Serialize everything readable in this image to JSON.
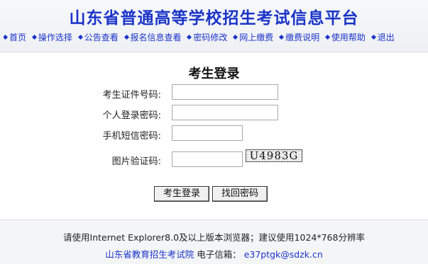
{
  "header": {
    "title": "山东省普通高等学校招生考试信息平台",
    "nav": [
      {
        "label": "首页",
        "icon": "diamond-bullet-icon"
      },
      {
        "label": "操作选择",
        "icon": "diamond-bullet-icon"
      },
      {
        "label": "公告查看",
        "icon": "diamond-bullet-icon"
      },
      {
        "label": "报名信息查看",
        "icon": "diamond-bullet-icon"
      },
      {
        "label": "密码修改",
        "icon": "diamond-bullet-icon"
      },
      {
        "label": "网上缴费",
        "icon": "diamond-bullet-icon"
      },
      {
        "label": "缴费说明",
        "icon": "diamond-bullet-icon"
      },
      {
        "label": "使用帮助",
        "icon": "diamond-bullet-icon"
      },
      {
        "label": "退出",
        "icon": "diamond-bullet-icon"
      }
    ],
    "accent_color": "#1a34c8"
  },
  "form": {
    "title": "考生登录",
    "id_label": "考生证件号码:",
    "id_value": "",
    "password_label": "个人登录密码:",
    "password_value": "",
    "sms_label": "手机短信密码:",
    "sms_value": "",
    "captcha_label": "图片验证码:",
    "captcha_value": "",
    "captcha_image_text": "U4983G",
    "login_button": "考生登录",
    "recover_button": "找回密码"
  },
  "footer": {
    "note": "请使用Internet Explorer8.0及以上版本浏览器；建议使用1024*768分辨率",
    "org": "山东省教育招生考试院",
    "email_label": "电子信箱：",
    "email": "e37ptgk@sdzk.cn"
  }
}
